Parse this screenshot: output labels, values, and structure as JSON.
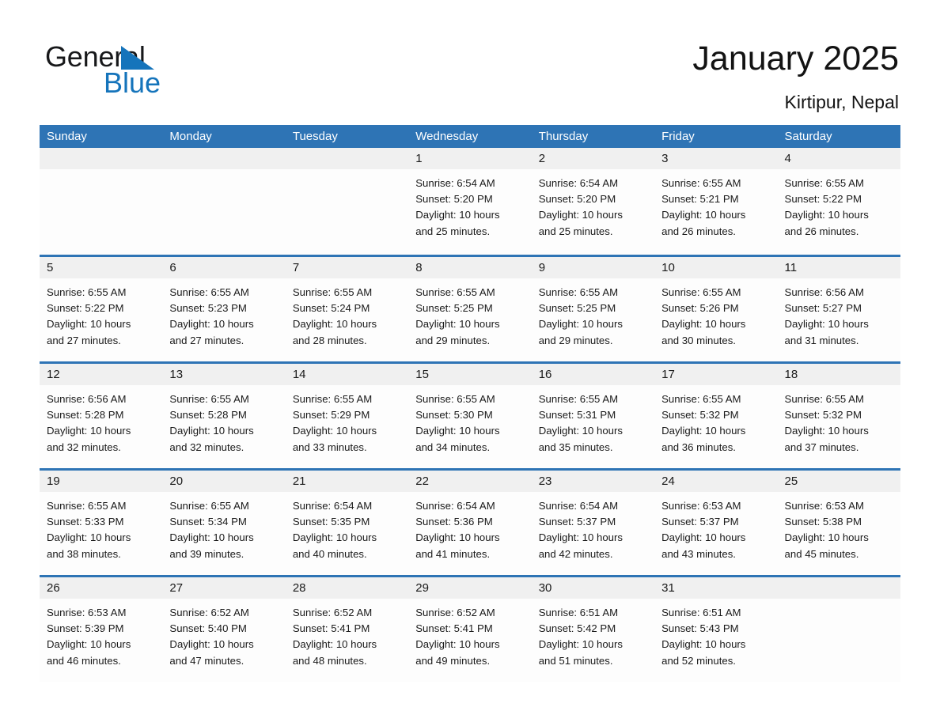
{
  "brand": {
    "name_part1": "General",
    "name_part2": "Blue",
    "accent_color": "#1574bb",
    "triangle_icon": "logo-triangle-icon"
  },
  "header": {
    "title": "January 2025",
    "subtitle": "Kirtipur, Nepal"
  },
  "theme": {
    "header_blue": "#2e74b5",
    "day_band_gray": "#f0f0f0",
    "cell_white": "#fdfdfd",
    "text_black": "#1a1a1a"
  },
  "weekdays": [
    "Sunday",
    "Monday",
    "Tuesday",
    "Wednesday",
    "Thursday",
    "Friday",
    "Saturday"
  ],
  "weeks": [
    [
      {
        "day": "",
        "lines": []
      },
      {
        "day": "",
        "lines": []
      },
      {
        "day": "",
        "lines": []
      },
      {
        "day": "1",
        "lines": [
          "Sunrise: 6:54 AM",
          "Sunset: 5:20 PM",
          "Daylight: 10 hours",
          "and 25 minutes."
        ]
      },
      {
        "day": "2",
        "lines": [
          "Sunrise: 6:54 AM",
          "Sunset: 5:20 PM",
          "Daylight: 10 hours",
          "and 25 minutes."
        ]
      },
      {
        "day": "3",
        "lines": [
          "Sunrise: 6:55 AM",
          "Sunset: 5:21 PM",
          "Daylight: 10 hours",
          "and 26 minutes."
        ]
      },
      {
        "day": "4",
        "lines": [
          "Sunrise: 6:55 AM",
          "Sunset: 5:22 PM",
          "Daylight: 10 hours",
          "and 26 minutes."
        ]
      }
    ],
    [
      {
        "day": "5",
        "lines": [
          "Sunrise: 6:55 AM",
          "Sunset: 5:22 PM",
          "Daylight: 10 hours",
          "and 27 minutes."
        ]
      },
      {
        "day": "6",
        "lines": [
          "Sunrise: 6:55 AM",
          "Sunset: 5:23 PM",
          "Daylight: 10 hours",
          "and 27 minutes."
        ]
      },
      {
        "day": "7",
        "lines": [
          "Sunrise: 6:55 AM",
          "Sunset: 5:24 PM",
          "Daylight: 10 hours",
          "and 28 minutes."
        ]
      },
      {
        "day": "8",
        "lines": [
          "Sunrise: 6:55 AM",
          "Sunset: 5:25 PM",
          "Daylight: 10 hours",
          "and 29 minutes."
        ]
      },
      {
        "day": "9",
        "lines": [
          "Sunrise: 6:55 AM",
          "Sunset: 5:25 PM",
          "Daylight: 10 hours",
          "and 29 minutes."
        ]
      },
      {
        "day": "10",
        "lines": [
          "Sunrise: 6:55 AM",
          "Sunset: 5:26 PM",
          "Daylight: 10 hours",
          "and 30 minutes."
        ]
      },
      {
        "day": "11",
        "lines": [
          "Sunrise: 6:56 AM",
          "Sunset: 5:27 PM",
          "Daylight: 10 hours",
          "and 31 minutes."
        ]
      }
    ],
    [
      {
        "day": "12",
        "lines": [
          "Sunrise: 6:56 AM",
          "Sunset: 5:28 PM",
          "Daylight: 10 hours",
          "and 32 minutes."
        ]
      },
      {
        "day": "13",
        "lines": [
          "Sunrise: 6:55 AM",
          "Sunset: 5:28 PM",
          "Daylight: 10 hours",
          "and 32 minutes."
        ]
      },
      {
        "day": "14",
        "lines": [
          "Sunrise: 6:55 AM",
          "Sunset: 5:29 PM",
          "Daylight: 10 hours",
          "and 33 minutes."
        ]
      },
      {
        "day": "15",
        "lines": [
          "Sunrise: 6:55 AM",
          "Sunset: 5:30 PM",
          "Daylight: 10 hours",
          "and 34 minutes."
        ]
      },
      {
        "day": "16",
        "lines": [
          "Sunrise: 6:55 AM",
          "Sunset: 5:31 PM",
          "Daylight: 10 hours",
          "and 35 minutes."
        ]
      },
      {
        "day": "17",
        "lines": [
          "Sunrise: 6:55 AM",
          "Sunset: 5:32 PM",
          "Daylight: 10 hours",
          "and 36 minutes."
        ]
      },
      {
        "day": "18",
        "lines": [
          "Sunrise: 6:55 AM",
          "Sunset: 5:32 PM",
          "Daylight: 10 hours",
          "and 37 minutes."
        ]
      }
    ],
    [
      {
        "day": "19",
        "lines": [
          "Sunrise: 6:55 AM",
          "Sunset: 5:33 PM",
          "Daylight: 10 hours",
          "and 38 minutes."
        ]
      },
      {
        "day": "20",
        "lines": [
          "Sunrise: 6:55 AM",
          "Sunset: 5:34 PM",
          "Daylight: 10 hours",
          "and 39 minutes."
        ]
      },
      {
        "day": "21",
        "lines": [
          "Sunrise: 6:54 AM",
          "Sunset: 5:35 PM",
          "Daylight: 10 hours",
          "and 40 minutes."
        ]
      },
      {
        "day": "22",
        "lines": [
          "Sunrise: 6:54 AM",
          "Sunset: 5:36 PM",
          "Daylight: 10 hours",
          "and 41 minutes."
        ]
      },
      {
        "day": "23",
        "lines": [
          "Sunrise: 6:54 AM",
          "Sunset: 5:37 PM",
          "Daylight: 10 hours",
          "and 42 minutes."
        ]
      },
      {
        "day": "24",
        "lines": [
          "Sunrise: 6:53 AM",
          "Sunset: 5:37 PM",
          "Daylight: 10 hours",
          "and 43 minutes."
        ]
      },
      {
        "day": "25",
        "lines": [
          "Sunrise: 6:53 AM",
          "Sunset: 5:38 PM",
          "Daylight: 10 hours",
          "and 45 minutes."
        ]
      }
    ],
    [
      {
        "day": "26",
        "lines": [
          "Sunrise: 6:53 AM",
          "Sunset: 5:39 PM",
          "Daylight: 10 hours",
          "and 46 minutes."
        ]
      },
      {
        "day": "27",
        "lines": [
          "Sunrise: 6:52 AM",
          "Sunset: 5:40 PM",
          "Daylight: 10 hours",
          "and 47 minutes."
        ]
      },
      {
        "day": "28",
        "lines": [
          "Sunrise: 6:52 AM",
          "Sunset: 5:41 PM",
          "Daylight: 10 hours",
          "and 48 minutes."
        ]
      },
      {
        "day": "29",
        "lines": [
          "Sunrise: 6:52 AM",
          "Sunset: 5:41 PM",
          "Daylight: 10 hours",
          "and 49 minutes."
        ]
      },
      {
        "day": "30",
        "lines": [
          "Sunrise: 6:51 AM",
          "Sunset: 5:42 PM",
          "Daylight: 10 hours",
          "and 51 minutes."
        ]
      },
      {
        "day": "31",
        "lines": [
          "Sunrise: 6:51 AM",
          "Sunset: 5:43 PM",
          "Daylight: 10 hours",
          "and 52 minutes."
        ]
      },
      {
        "day": "",
        "lines": []
      }
    ]
  ]
}
